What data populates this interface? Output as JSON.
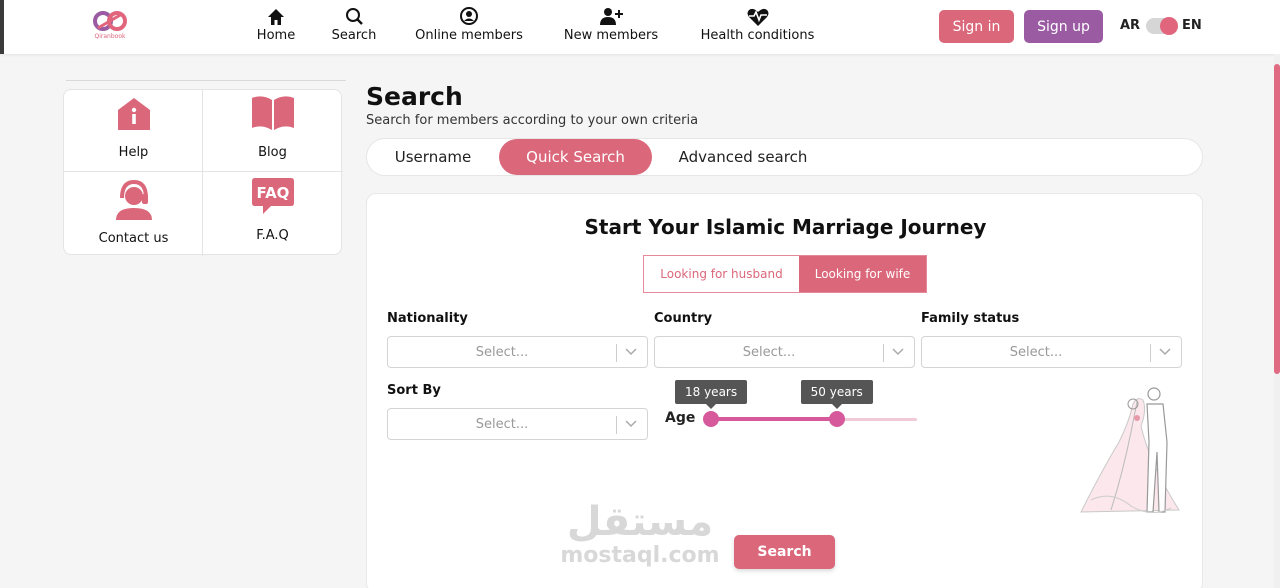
{
  "brand": {
    "name": "Qiranbook",
    "accent": "#db677a",
    "secondary": "#9a5ba3"
  },
  "nav": {
    "items": [
      {
        "label": "Home",
        "icon": "home-icon"
      },
      {
        "label": "Search",
        "icon": "search-icon"
      },
      {
        "label": "Online members",
        "icon": "user-circle-icon"
      },
      {
        "label": "New members",
        "icon": "user-plus-icon"
      },
      {
        "label": "Health conditions",
        "icon": "heartbeat-icon"
      }
    ]
  },
  "auth": {
    "signin": "Sign in",
    "signup": "Sign up"
  },
  "lang": {
    "ar": "AR",
    "en": "EN"
  },
  "sidebar": {
    "items": [
      {
        "label": "Help",
        "icon": "info-house-icon"
      },
      {
        "label": "Blog",
        "icon": "book-icon"
      },
      {
        "label": "Contact us",
        "icon": "support-icon"
      },
      {
        "label": "F.A.Q",
        "icon": "faq-icon"
      }
    ]
  },
  "main": {
    "title": "Search",
    "subtitle": "Search for members according to your own criteria",
    "tabs": [
      {
        "label": "Username",
        "active": false
      },
      {
        "label": "Quick Search",
        "active": true
      },
      {
        "label": "Advanced search",
        "active": false
      }
    ]
  },
  "form": {
    "heading": "Start Your Islamic Marriage Journey",
    "looking": {
      "husband": "Looking for husband",
      "wife": "Looking for wife",
      "selected": "wife"
    },
    "nationality": {
      "label": "Nationality",
      "placeholder": "Select..."
    },
    "country": {
      "label": "Country",
      "placeholder": "Select..."
    },
    "family_status": {
      "label": "Family status",
      "placeholder": "Select..."
    },
    "sort_by": {
      "label": "Sort By",
      "placeholder": "Select..."
    },
    "age": {
      "label": "Age",
      "min_label": "18 years",
      "max_label": "50 years",
      "min_fraction": 0.0,
      "max_fraction": 0.61
    },
    "submit": "Search"
  },
  "watermark": {
    "ar": "مستقل",
    "en": "mostaql.com"
  }
}
